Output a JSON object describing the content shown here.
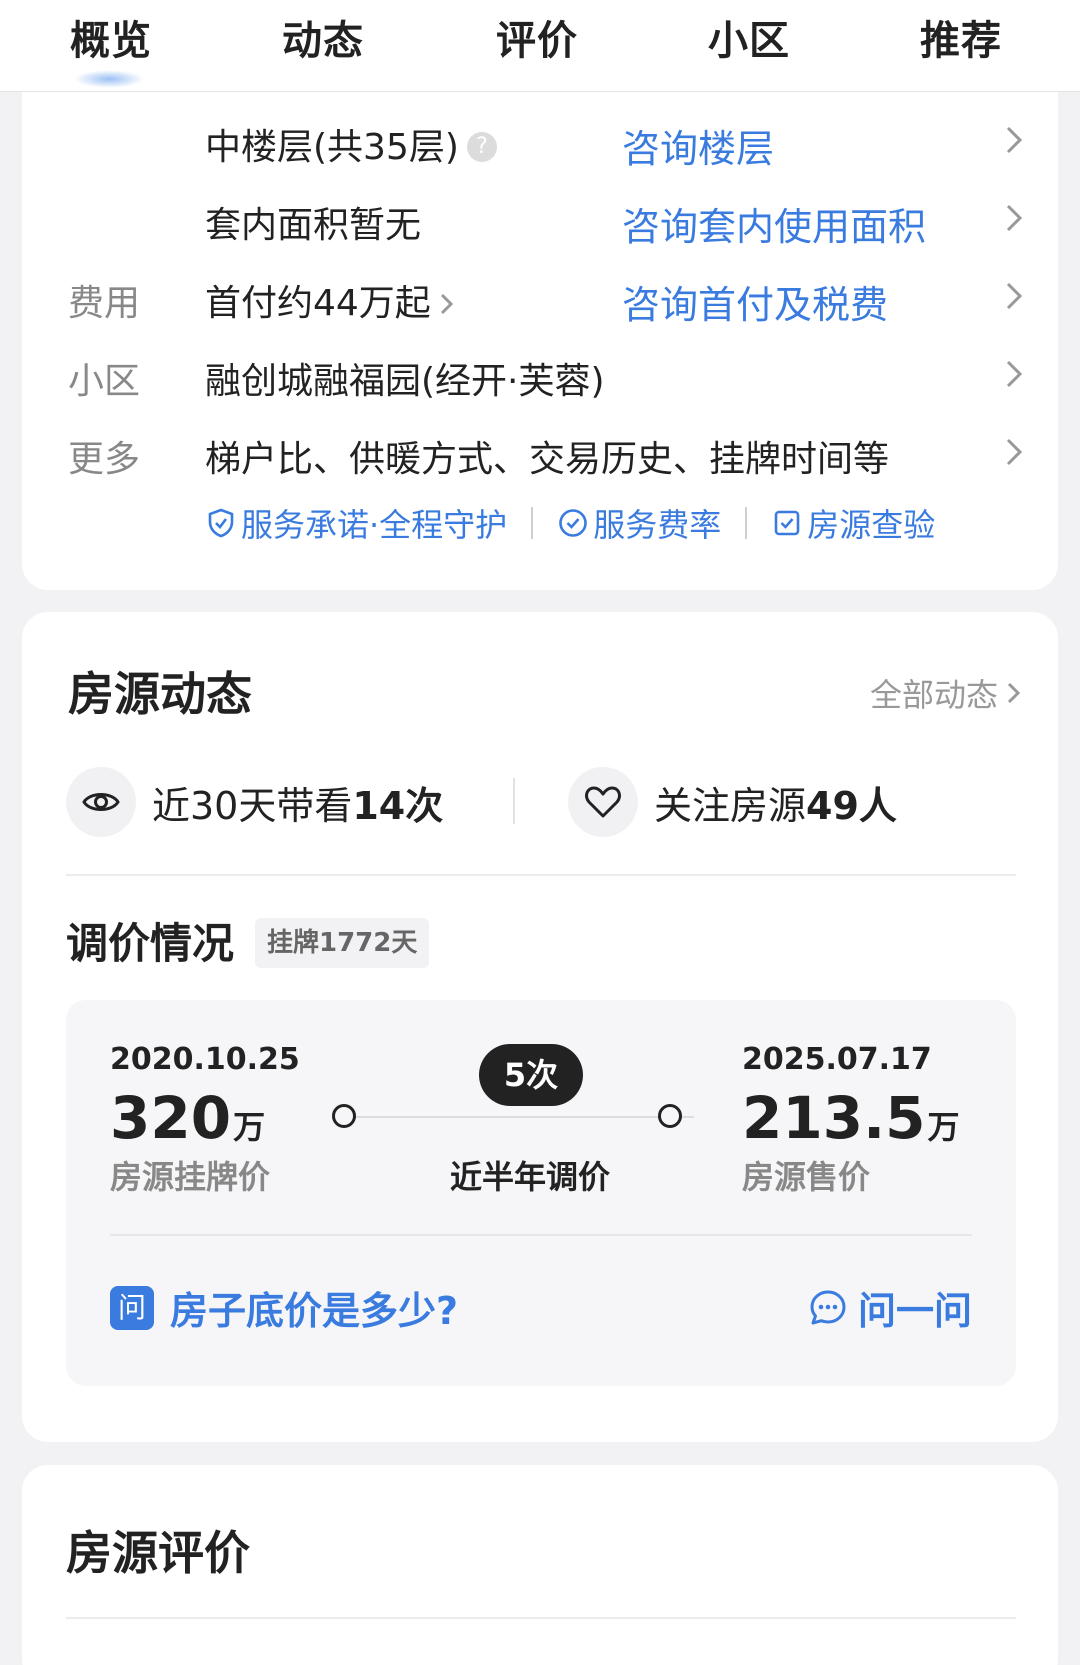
{
  "tabs": [
    "概览",
    "动态",
    "评价",
    "小区",
    "推荐"
  ],
  "details": [
    {
      "label": "",
      "value": "中楼层(共35层)",
      "link": "咨询楼层"
    },
    {
      "label": "",
      "value": "套内面积暂无",
      "link": "咨询套内使用面积"
    },
    {
      "label": "费用",
      "value": "首付约44万起",
      "link": "咨询首付及税费"
    },
    {
      "label": "小区",
      "value": "融创城融福园(经开·芙蓉)",
      "link": ""
    },
    {
      "label": "更多",
      "value": "梯户比、供暖方式、交易历史、挂牌时间等",
      "link": ""
    }
  ],
  "services": [
    "服务承诺·全程守护",
    "服务费率",
    "房源查验"
  ],
  "dynamics": {
    "title": "房源动态",
    "all_link": "全部动态",
    "views_prefix": "近30天带看",
    "views_value": "14次",
    "follows_prefix": "关注房源",
    "follows_value": "49人"
  },
  "price_adjust": {
    "title": "调价情况",
    "tag": "挂牌1772天",
    "start_date": "2020.10.25",
    "start_price": "320",
    "start_unit": "万",
    "start_caption": "房源挂牌价",
    "count": "5次",
    "mid_caption": "近半年调价",
    "end_date": "2025.07.17",
    "end_price": "213.5",
    "end_unit": "万",
    "end_caption": "房源售价",
    "question_icon": "问",
    "question": "房子底价是多少?",
    "ask": "问一问"
  },
  "review": {
    "title": "房源评价"
  },
  "colors": {
    "accent": "#3a7be0",
    "text": "#222222",
    "muted": "#888888"
  }
}
